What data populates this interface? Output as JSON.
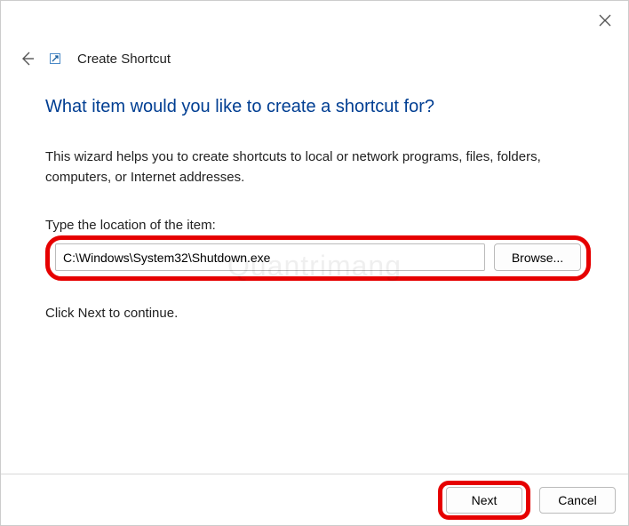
{
  "window": {
    "wizard_title": "Create Shortcut"
  },
  "content": {
    "heading": "What item would you like to create a shortcut for?",
    "description": "This wizard helps you to create shortcuts to local or network programs, files, folders, computers, or Internet addresses.",
    "location_label": "Type the location of the item:",
    "location_value": "C:\\Windows\\System32\\Shutdown.exe",
    "browse_label": "Browse...",
    "continue_text": "Click Next to continue."
  },
  "footer": {
    "next_label": "Next",
    "cancel_label": "Cancel"
  },
  "watermark": "Quantrimang"
}
